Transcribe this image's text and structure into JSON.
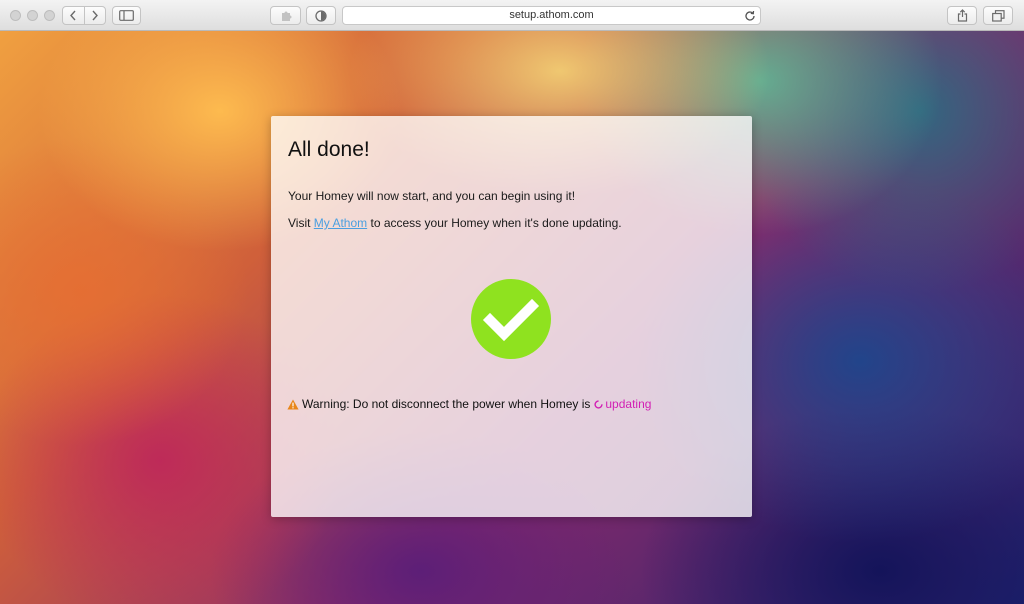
{
  "browser": {
    "url": "setup.athom.com"
  },
  "card": {
    "title": "All done!",
    "line1": "Your Homey will now start, and you can begin using it!",
    "line2_prefix": "Visit ",
    "line2_link": "My Athom",
    "line2_suffix": " to access your Homey when it's done updating.",
    "warning_text": "Warning: Do not disconnect the power when Homey is",
    "status_text": "updating"
  },
  "colors": {
    "check": "#8fe21f",
    "link": "#4a9fe0",
    "status": "#d21fb4",
    "warning_icon": "#e8861a"
  },
  "icons": {
    "back": "chevron-left-icon",
    "forward": "chevron-right-icon",
    "sidebar": "sidebar-icon",
    "extension": "puzzle-icon",
    "privacy": "shield-icon",
    "reload": "reload-icon",
    "share": "share-icon",
    "tabs": "tabs-icon",
    "success": "checkmark-icon",
    "warning": "warning-triangle-icon",
    "status": "spinner-icon"
  }
}
